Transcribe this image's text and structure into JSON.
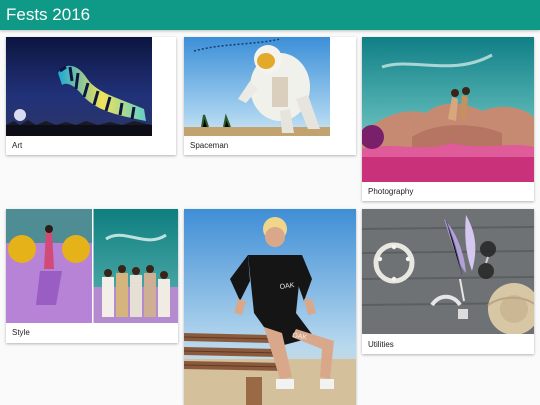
{
  "app": {
    "title": "Fests 2016"
  },
  "cards": [
    {
      "label": "Art"
    },
    {
      "label": "Spaceman"
    },
    {
      "label": "Photography"
    },
    {
      "label": "Style"
    },
    {
      "label": ""
    },
    {
      "label": "Utilities"
    }
  ],
  "colors": {
    "accent": "#0e9a86"
  }
}
